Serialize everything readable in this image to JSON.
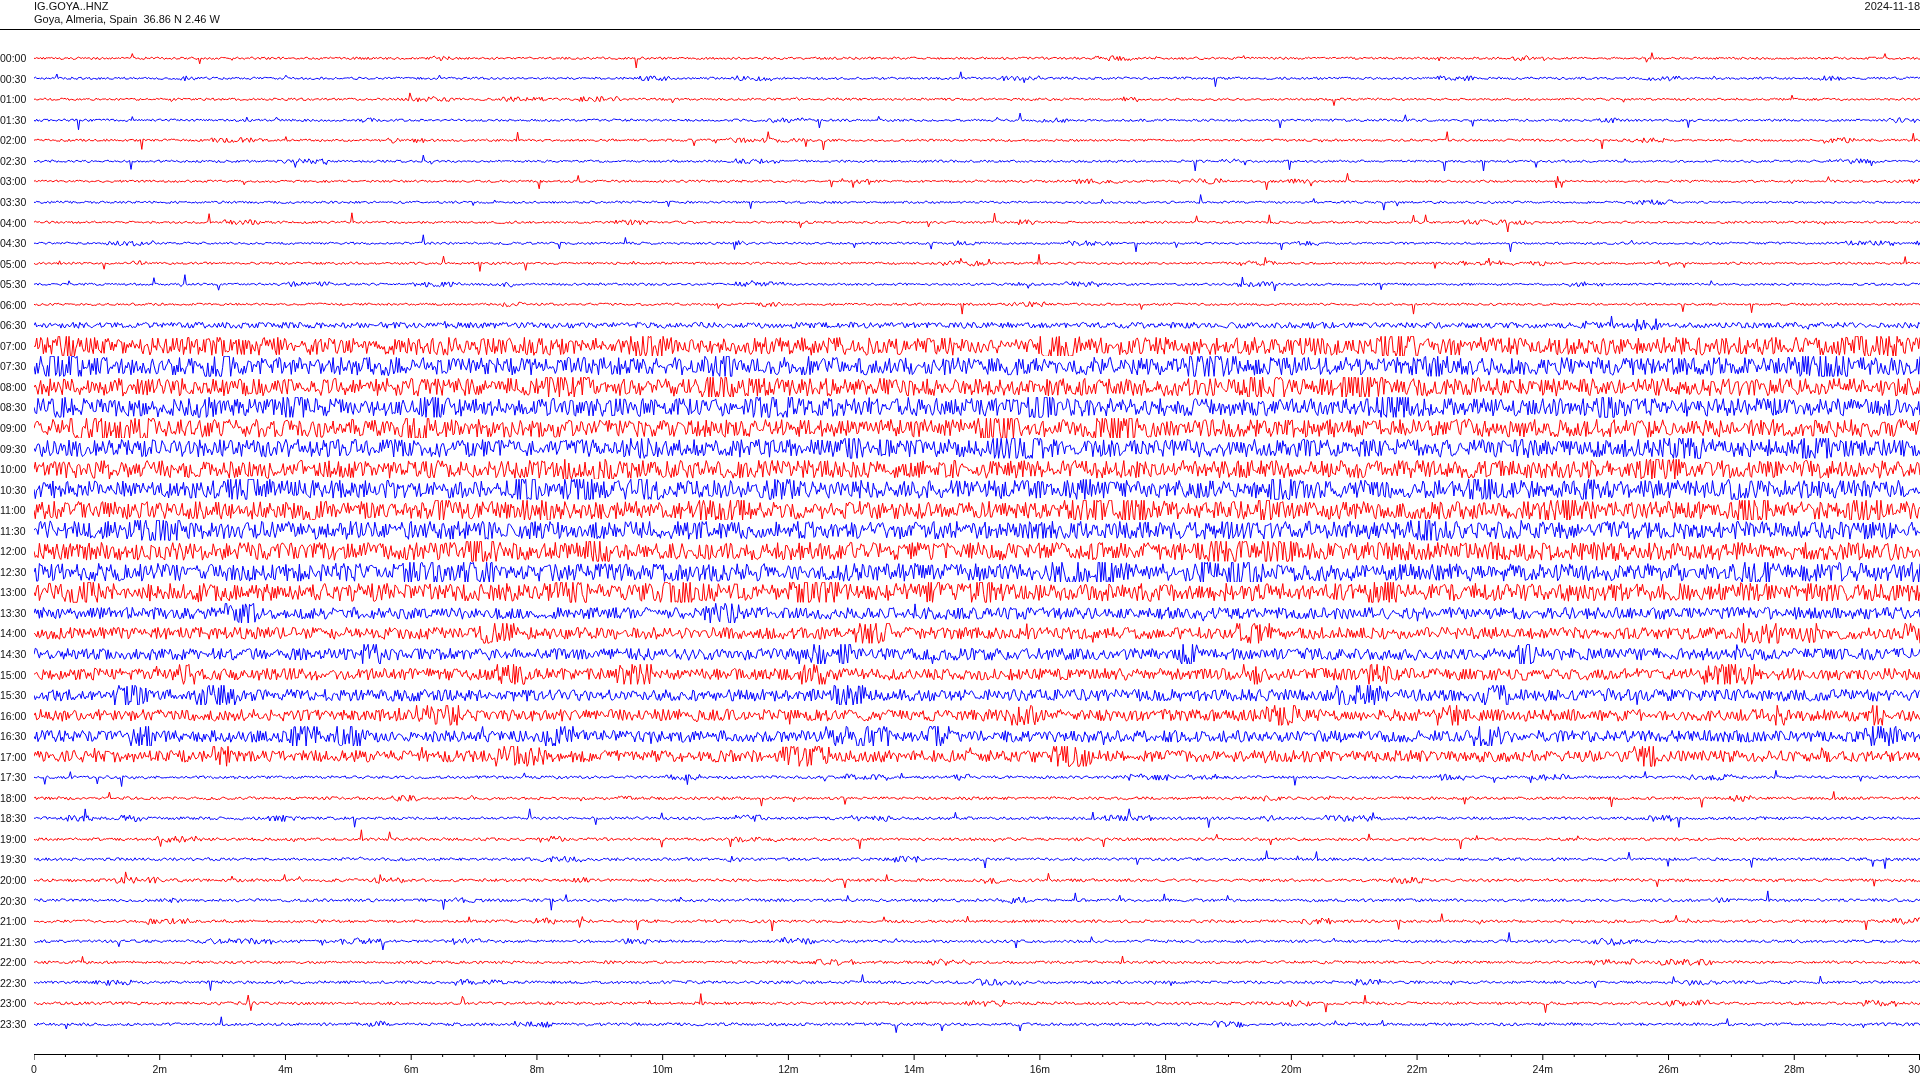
{
  "header": {
    "station": "IG.GOYA..HNZ",
    "location": "Goya, Almeria, Spain  36.86 N 2.46 W",
    "date": "2024-11-18"
  },
  "rows": [
    {
      "time": "00:00",
      "color": "#ff0000"
    },
    {
      "time": "00:30",
      "color": "#0000ff"
    },
    {
      "time": "01:00",
      "color": "#ff0000"
    },
    {
      "time": "01:30",
      "color": "#0000ff"
    },
    {
      "time": "02:00",
      "color": "#ff0000"
    },
    {
      "time": "02:30",
      "color": "#0000ff"
    },
    {
      "time": "03:00",
      "color": "#ff0000"
    },
    {
      "time": "03:30",
      "color": "#0000ff"
    },
    {
      "time": "04:00",
      "color": "#ff0000"
    },
    {
      "time": "04:30",
      "color": "#0000ff"
    },
    {
      "time": "05:00",
      "color": "#ff0000"
    },
    {
      "time": "05:30",
      "color": "#0000ff"
    },
    {
      "time": "06:00",
      "color": "#ff0000"
    },
    {
      "time": "06:30",
      "color": "#0000ff"
    },
    {
      "time": "07:00",
      "color": "#ff0000"
    },
    {
      "time": "07:30",
      "color": "#0000ff"
    },
    {
      "time": "08:00",
      "color": "#ff0000"
    },
    {
      "time": "08:30",
      "color": "#0000ff"
    },
    {
      "time": "09:00",
      "color": "#ff0000"
    },
    {
      "time": "09:30",
      "color": "#0000ff"
    },
    {
      "time": "10:00",
      "color": "#ff0000"
    },
    {
      "time": "10:30",
      "color": "#0000ff"
    },
    {
      "time": "11:00",
      "color": "#ff0000"
    },
    {
      "time": "11:30",
      "color": "#0000ff"
    },
    {
      "time": "12:00",
      "color": "#ff0000"
    },
    {
      "time": "12:30",
      "color": "#0000ff"
    },
    {
      "time": "13:00",
      "color": "#ff0000"
    },
    {
      "time": "13:30",
      "color": "#0000ff"
    },
    {
      "time": "14:00",
      "color": "#ff0000"
    },
    {
      "time": "14:30",
      "color": "#0000ff"
    },
    {
      "time": "15:00",
      "color": "#ff0000"
    },
    {
      "time": "15:30",
      "color": "#0000ff"
    },
    {
      "time": "16:00",
      "color": "#ff0000"
    },
    {
      "time": "16:30",
      "color": "#0000ff"
    },
    {
      "time": "17:00",
      "color": "#ff0000"
    },
    {
      "time": "17:30",
      "color": "#0000ff"
    },
    {
      "time": "18:00",
      "color": "#ff0000"
    },
    {
      "time": "18:30",
      "color": "#0000ff"
    },
    {
      "time": "19:00",
      "color": "#ff0000"
    },
    {
      "time": "19:30",
      "color": "#0000ff"
    },
    {
      "time": "20:00",
      "color": "#ff0000"
    },
    {
      "time": "20:30",
      "color": "#0000ff"
    },
    {
      "time": "21:00",
      "color": "#ff0000"
    },
    {
      "time": "21:30",
      "color": "#0000ff"
    },
    {
      "time": "22:00",
      "color": "#ff0000"
    },
    {
      "time": "22:30",
      "color": "#0000ff"
    },
    {
      "time": "23:00",
      "color": "#ff0000"
    },
    {
      "time": "23:30",
      "color": "#0000ff"
    }
  ],
  "x_axis": {
    "labels": [
      "0",
      "2m",
      "4m",
      "6m",
      "8m",
      "10m",
      "12m",
      "14m",
      "16m",
      "18m",
      "20m",
      "22m",
      "24m",
      "26m",
      "28m",
      "30"
    ]
  }
}
